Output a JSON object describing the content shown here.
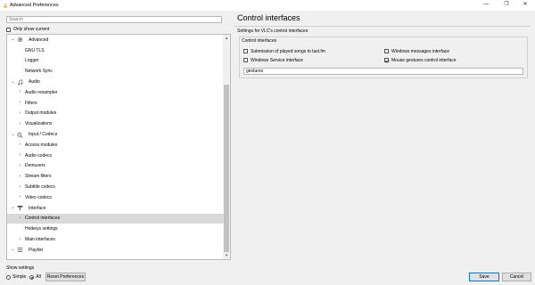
{
  "window": {
    "title": "Advanced Preferences",
    "minimize": "—",
    "maximize": "❐",
    "close": "✕"
  },
  "search": {
    "placeholder": "Search"
  },
  "only_shown": {
    "label": "Only show current",
    "checked": false
  },
  "tree": [
    {
      "label": "Advanced",
      "level": 0,
      "expanded": true,
      "icon": "gear-icon"
    },
    {
      "label": "GNU TLS",
      "level": 1
    },
    {
      "label": "Logger",
      "level": 1
    },
    {
      "label": "Network Sync",
      "level": 1
    },
    {
      "label": "Audio",
      "level": 0,
      "expanded": true,
      "icon": "music-note-icon"
    },
    {
      "label": "Audio resampler",
      "level": 1,
      "has_children": true
    },
    {
      "label": "Filters",
      "level": 1,
      "has_children": true
    },
    {
      "label": "Output modules",
      "level": 1,
      "has_children": true
    },
    {
      "label": "Visualizations",
      "level": 1,
      "has_children": true
    },
    {
      "label": "Input / Codecs",
      "level": 0,
      "expanded": true,
      "icon": "input-codecs-icon"
    },
    {
      "label": "Access modules",
      "level": 1,
      "has_children": true
    },
    {
      "label": "Audio codecs",
      "level": 1,
      "has_children": true
    },
    {
      "label": "Demuxers",
      "level": 1,
      "has_children": true
    },
    {
      "label": "Stream filters",
      "level": 1,
      "has_children": true
    },
    {
      "label": "Subtitle codecs",
      "level": 1,
      "has_children": true
    },
    {
      "label": "Video codecs",
      "level": 1,
      "has_children": true
    },
    {
      "label": "Interface",
      "level": 0,
      "expanded": true,
      "icon": "interface-icon"
    },
    {
      "label": "Control interfaces",
      "level": 1,
      "has_children": true,
      "selected": true
    },
    {
      "label": "Hotkeys settings",
      "level": 1
    },
    {
      "label": "Main interfaces",
      "level": 1,
      "has_children": true
    },
    {
      "label": "Playlist",
      "level": 0,
      "expanded": true,
      "icon": "playlist-icon"
    }
  ],
  "show_settings": {
    "label": "Show settings",
    "simple": "Simple",
    "all": "All",
    "selected": "All"
  },
  "buttons": {
    "reset": "Reset Preferences",
    "save": "Save",
    "cancel": "Cancel"
  },
  "panel": {
    "title": "Control interfaces",
    "subtitle": "Settings for VLC's control interfaces",
    "group_title": "Control interfaces",
    "options": [
      {
        "label": "Submission of played songs to last.fm",
        "checked": false
      },
      {
        "label": "Windows messages interface",
        "checked": false
      },
      {
        "label": "Windows Service interface",
        "checked": false
      },
      {
        "label": "Mouse gestures control interface",
        "checked": true
      }
    ],
    "text_value": "gestures"
  },
  "colors": {
    "selected_row": "#d9d9d9",
    "window_bg": "#f0f0f0",
    "accent": "#0078d7"
  }
}
